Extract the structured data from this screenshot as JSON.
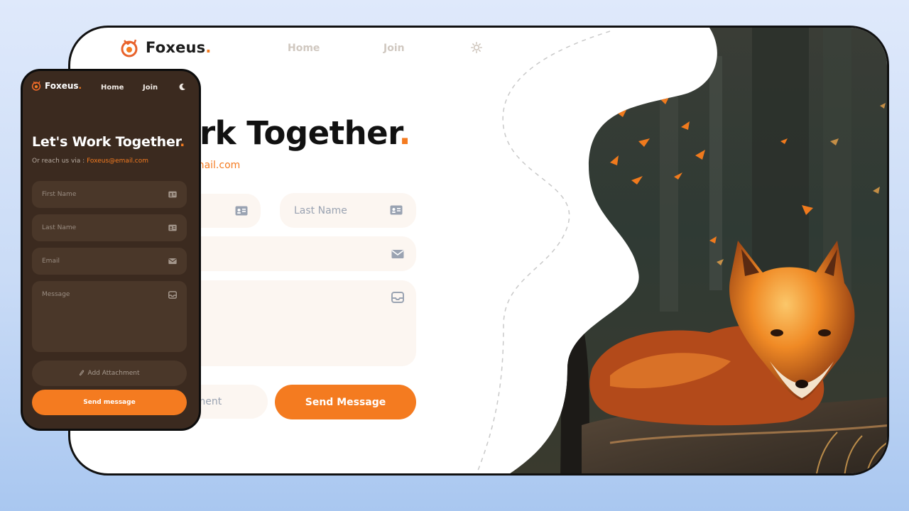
{
  "brand": {
    "name": "Foxeus",
    "accent_dot": "."
  },
  "colors": {
    "accent": "#f47b20",
    "desktop_bg": "#ffffff",
    "mobile_bg": "#3b2a1f",
    "field_light": "#fcf6f1",
    "field_dark": "#4a3729"
  },
  "desktop": {
    "nav": {
      "home": "Home",
      "join": "Join",
      "theme_icon": "sun-icon"
    },
    "title": "Work Together",
    "title_dot": ".",
    "email": "Foxeus@email.com",
    "fields": {
      "last_name": "Last Name"
    },
    "buttons": {
      "attachment_partial": "chment",
      "send": "Send Message"
    },
    "illustration": "fox-in-autumn-forest"
  },
  "mobile": {
    "nav": {
      "home": "Home",
      "join": "Join",
      "theme_icon": "moon-icon"
    },
    "title": "Let's Work Together",
    "title_dot": ".",
    "reach_prefix": "Or reach us via : ",
    "email": "Foxeus@email.com",
    "fields": {
      "first_name": "First Name",
      "last_name": "Last Name",
      "email": "Email",
      "message": "Message"
    },
    "buttons": {
      "attachment": "Add Attachment",
      "send": "Send message"
    }
  }
}
